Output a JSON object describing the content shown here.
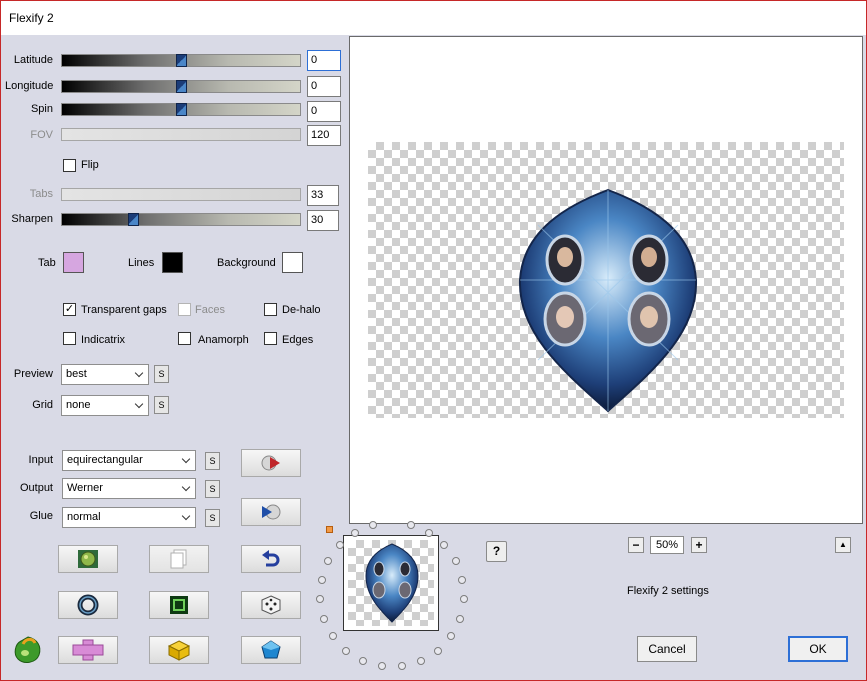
{
  "window": {
    "title": "Flexify 2"
  },
  "params": {
    "latitude": {
      "label": "Latitude",
      "value": "0",
      "level": 0.5
    },
    "longitude": {
      "label": "Longitude",
      "value": "0",
      "level": 0.5
    },
    "spin": {
      "label": "Spin",
      "value": "0",
      "level": 0.5
    },
    "fov": {
      "label": "FOV",
      "value": "120"
    },
    "flip": {
      "label": "Flip",
      "checked": false
    },
    "tabs": {
      "label": "Tabs",
      "value": "33"
    },
    "sharpen": {
      "label": "Sharpen",
      "value": "30",
      "level": 0.3
    }
  },
  "colors": {
    "tab": {
      "label": "Tab",
      "color": "#d6a6e0"
    },
    "lines": {
      "label": "Lines",
      "color": "#000000"
    },
    "background": {
      "label": "Background",
      "color": "#ffffff"
    }
  },
  "options": {
    "transparent_gaps": {
      "label": "Transparent gaps",
      "checked": true
    },
    "faces": {
      "label": "Faces",
      "checked": false
    },
    "de_halo": {
      "label": "De-halo",
      "checked": false
    },
    "indicatrix": {
      "label": "Indicatrix",
      "checked": false
    },
    "anamorph": {
      "label": "Anamorph",
      "checked": false
    },
    "edges": {
      "label": "Edges",
      "checked": false
    }
  },
  "preview_settings": {
    "preview": {
      "label": "Preview",
      "value": "best"
    },
    "grid": {
      "label": "Grid",
      "value": "none"
    }
  },
  "projection": {
    "input": {
      "label": "Input",
      "value": "equirectangular"
    },
    "output": {
      "label": "Output",
      "value": "Werner"
    },
    "glue": {
      "label": "Glue",
      "value": "normal"
    }
  },
  "s_button": "S",
  "zoom": {
    "value": "50%",
    "minus": "−",
    "plus": "+"
  },
  "help": "?",
  "collapse": "▲",
  "settings_label": "Flexify 2 settings",
  "buttons": {
    "cancel": "Cancel",
    "ok": "OK"
  },
  "accent": "#2d6fd6"
}
